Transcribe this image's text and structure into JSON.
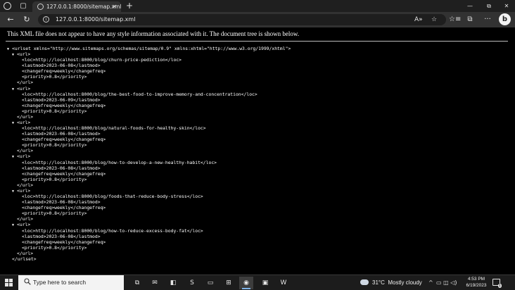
{
  "browser": {
    "tab": {
      "title": "127.0.0.1:8000/sitemap.xml",
      "close": "✕"
    },
    "new_tab": "+",
    "address_bar": {
      "url": "127.0.0.1:8000/sitemap.xml",
      "read_aloud": "A»",
      "favorite": "☆"
    },
    "window_controls": {
      "minimize": "—",
      "restore": "⧉",
      "close": "✕"
    },
    "nav": {
      "back": "←",
      "refresh": "↻"
    },
    "toolbar": {
      "favorites": "☆≡",
      "collections": "⧉",
      "more": "···",
      "bing": "b"
    }
  },
  "page": {
    "notice": "This XML file does not appear to have any style information associated with it. The document tree is shown below.",
    "lines": [
      {
        "indent": 0,
        "toggle": "▼",
        "text": "<urlset xmlns=\"http://www.sitemaps.org/schemas/sitemap/0.9\" xmlns:xhtml=\"http://www.w3.org/1999/xhtml\">"
      },
      {
        "indent": 1,
        "toggle": "▼",
        "text": "<url>"
      },
      {
        "indent": 2,
        "toggle": "",
        "text": "<loc>http://localhost:8000/blog/churn-price-pediction</loc>"
      },
      {
        "indent": 2,
        "toggle": "",
        "text": "<lastmod>2023-06-08</lastmod>"
      },
      {
        "indent": 2,
        "toggle": "",
        "text": "<changefreq>weekly</changefreq>"
      },
      {
        "indent": 2,
        "toggle": "",
        "text": "<priority>0.8</priority>"
      },
      {
        "indent": 1,
        "toggle": "",
        "text": "</url>"
      },
      {
        "indent": 1,
        "toggle": "▼",
        "text": "<url>"
      },
      {
        "indent": 2,
        "toggle": "",
        "text": "<loc>http://localhost:8000/blog/the-best-food-to-improve-memory-and-concentration</loc>"
      },
      {
        "indent": 2,
        "toggle": "",
        "text": "<lastmod>2023-06-09</lastmod>"
      },
      {
        "indent": 2,
        "toggle": "",
        "text": "<changefreq>weekly</changefreq>"
      },
      {
        "indent": 2,
        "toggle": "",
        "text": "<priority>0.8</priority>"
      },
      {
        "indent": 1,
        "toggle": "",
        "text": "</url>"
      },
      {
        "indent": 1,
        "toggle": "▼",
        "text": "<url>"
      },
      {
        "indent": 2,
        "toggle": "",
        "text": "<loc>http://localhost:8000/blog/natural-foods-for-healthy-skin</loc>"
      },
      {
        "indent": 2,
        "toggle": "",
        "text": "<lastmod>2023-06-08</lastmod>"
      },
      {
        "indent": 2,
        "toggle": "",
        "text": "<changefreq>weekly</changefreq>"
      },
      {
        "indent": 2,
        "toggle": "",
        "text": "<priority>0.8</priority>"
      },
      {
        "indent": 1,
        "toggle": "",
        "text": "</url>"
      },
      {
        "indent": 1,
        "toggle": "▼",
        "text": "<url>"
      },
      {
        "indent": 2,
        "toggle": "",
        "text": "<loc>http://localhost:8000/blog/how-to-develop-a-new-healthy-habit</loc>"
      },
      {
        "indent": 2,
        "toggle": "",
        "text": "<lastmod>2023-06-08</lastmod>"
      },
      {
        "indent": 2,
        "toggle": "",
        "text": "<changefreq>weekly</changefreq>"
      },
      {
        "indent": 2,
        "toggle": "",
        "text": "<priority>0.8</priority>"
      },
      {
        "indent": 1,
        "toggle": "",
        "text": "</url>"
      },
      {
        "indent": 1,
        "toggle": "▼",
        "text": "<url>"
      },
      {
        "indent": 2,
        "toggle": "",
        "text": "<loc>http://localhost:8000/blog/foods-that-reduce-body-stress</loc>"
      },
      {
        "indent": 2,
        "toggle": "",
        "text": "<lastmod>2023-06-08</lastmod>"
      },
      {
        "indent": 2,
        "toggle": "",
        "text": "<changefreq>weekly</changefreq>"
      },
      {
        "indent": 2,
        "toggle": "",
        "text": "<priority>0.8</priority>"
      },
      {
        "indent": 1,
        "toggle": "",
        "text": "</url>"
      },
      {
        "indent": 1,
        "toggle": "▼",
        "text": "<url>"
      },
      {
        "indent": 2,
        "toggle": "",
        "text": "<loc>http://localhost:8000/blog/how-to-reduce-excess-body-fat</loc>"
      },
      {
        "indent": 2,
        "toggle": "",
        "text": "<lastmod>2023-06-08</lastmod>"
      },
      {
        "indent": 2,
        "toggle": "",
        "text": "<changefreq>weekly</changefreq>"
      },
      {
        "indent": 2,
        "toggle": "",
        "text": "<priority>0.8</priority>"
      },
      {
        "indent": 1,
        "toggle": "",
        "text": "</url>"
      },
      {
        "indent": 0,
        "toggle": "",
        "text": "</urlset>"
      }
    ]
  },
  "taskbar": {
    "search_placeholder": "Type here to search",
    "apps": [
      {
        "name": "task-view-icon",
        "glyph": "⧉"
      },
      {
        "name": "mail-icon",
        "glyph": "✉"
      },
      {
        "name": "app-icon",
        "glyph": "◧"
      },
      {
        "name": "app-icon",
        "glyph": "S"
      },
      {
        "name": "file-explorer-icon",
        "glyph": "▭"
      },
      {
        "name": "store-icon",
        "glyph": "⊞"
      },
      {
        "name": "edge-icon",
        "glyph": "◉"
      },
      {
        "name": "app-icon",
        "glyph": "▣"
      },
      {
        "name": "word-icon",
        "glyph": "W"
      }
    ],
    "weather": {
      "temp": "31°C",
      "condition": "Mostly cloudy"
    },
    "tray": {
      "chevron": "^",
      "icons": "▭ ◫ ◁)"
    },
    "clock": {
      "time": "4:53 PM",
      "date": "6/19/2023"
    },
    "notifications": "1",
    "accent": "#7fb4e8"
  }
}
